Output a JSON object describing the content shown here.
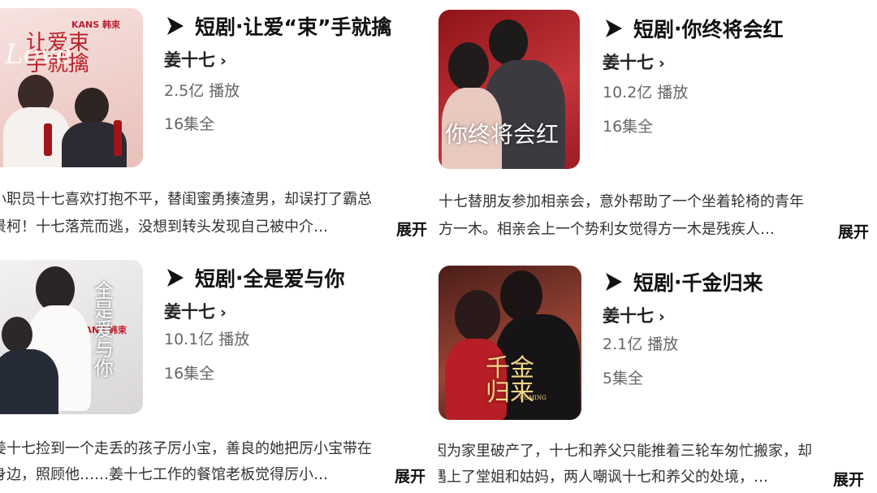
{
  "dramas": [
    {
      "category": "短剧",
      "sep": " · ",
      "name": "让爱“束”手就擒",
      "author": "姜十七",
      "author_chevron": "›",
      "plays": "2.5亿 播放",
      "episodes": "16集全",
      "desc_line1": "小职员十七喜欢打抱不平，替闺蜜勇揍渣男，却误打了霸总",
      "desc_line2": "景柯！十七落荒而逃，没想到转头发现自己被中介…",
      "expand": "展开",
      "poster_text": "让爱束手就擒",
      "poster_brand": "KANS 韩束",
      "poster_script": "Love",
      "bg": "#f1d7d3"
    },
    {
      "category": "短剧",
      "sep": " · ",
      "name": "你终将会红",
      "author": "姜十七",
      "author_chevron": "›",
      "plays": "10.2亿 播放",
      "episodes": "16集全",
      "desc_line1": "十七替朋友参加相亲会，意外帮助了一个坐着轮椅的青年",
      "desc_line2": "方一木。相亲会上一个势利女觉得方一木是残疾人…",
      "expand": "展开",
      "poster_text": "你终将会红",
      "bg": "#b8282e"
    },
    {
      "category": "短剧",
      "sep": " · ",
      "name": "全是爱与你",
      "author": "姜十七",
      "author_chevron": "›",
      "plays": "10.1亿 播放",
      "episodes": "16集全",
      "desc_line1": "姜十七捡到一个走丢的孩子厉小宝，善良的她把厉小宝带在",
      "desc_line2": "身边，照顾他……姜十七工作的餐馆老板觉得厉小…",
      "expand": "展开",
      "poster_text": "全是爱与你",
      "poster_brand": "KANS 韩束",
      "bg": "#e9e6e6"
    },
    {
      "category": "短剧",
      "sep": " · ",
      "name": "千金归来",
      "author": "姜十七",
      "author_chevron": "›",
      "plays": "2.1亿 播放",
      "episodes": "5集全",
      "desc_line1": "因为家里破产了，十七和养父只能推着三轮车匆忙搬家，却",
      "desc_line2": "遇上了堂姐和姑妈，两人嘲讽十七和养父的处境，…",
      "expand": "展开",
      "poster_text": "千金归来",
      "poster_script": "COMING",
      "bg": "#7a3328"
    }
  ],
  "colors": {
    "title": "#111111",
    "meta": "#666666",
    "desc": "#333333"
  }
}
